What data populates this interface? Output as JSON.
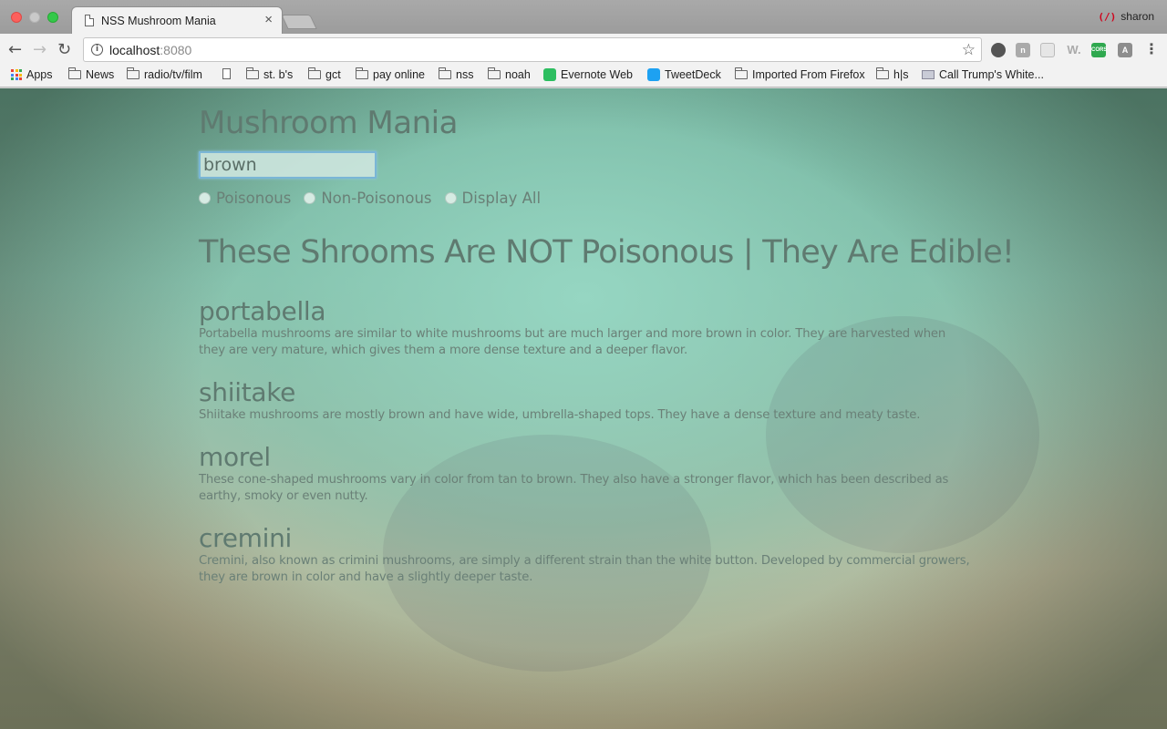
{
  "browser": {
    "tab_title": "NSS Mushroom Mania",
    "tab_close": "×",
    "profile_name": "sharon",
    "profile_icon": "(/)",
    "url_host": "localhost",
    "url_port": ":8080",
    "back": "←",
    "forward": "→",
    "reload": "↻",
    "star": "☆",
    "menu": "⋮",
    "ext_n": "n",
    "ext_w": "W.",
    "ext_cors": "CORS",
    "ext_angular": "A",
    "bookmarks": {
      "apps": "Apps",
      "news": "News",
      "radio": "radio/tv/film",
      "stbs": "st. b's",
      "gct": "gct",
      "pay": "pay online",
      "nss": "nss",
      "noah": "noah",
      "evernote": "Evernote Web",
      "tweetdeck": "TweetDeck",
      "firefox": "Imported From Firefox",
      "hs": "h|s",
      "trump": "Call Trump's White..."
    }
  },
  "page": {
    "title": "Mushroom Mania",
    "search_value": "brown",
    "radios": {
      "poisonous": "Poisonous",
      "non_poisonous": "Non-Poisonous",
      "display_all": "Display All"
    },
    "heading": "These Shrooms Are NOT Poisonous | They Are Edible!",
    "mushrooms": [
      {
        "name": "portabella",
        "description": "Portabella mushrooms are similar to white mushrooms but are much larger and more brown in color. They are harvested when they are very mature, which gives them a more dense texture and a deeper flavor."
      },
      {
        "name": "shiitake",
        "description": "Shiitake mushrooms are mostly brown and have wide, umbrella-shaped tops. They have a dense texture and meaty taste."
      },
      {
        "name": "morel",
        "description": "These cone-shaped mushrooms vary in color from tan to brown. They also have a stronger flavor, which has been described as earthy, smoky or even nutty."
      },
      {
        "name": "cremini",
        "description": "Cremini, also known as crimini mushrooms, are simply a different strain than the white button. Developed by commercial growers, they are brown in color and have a slightly deeper taste."
      }
    ]
  }
}
